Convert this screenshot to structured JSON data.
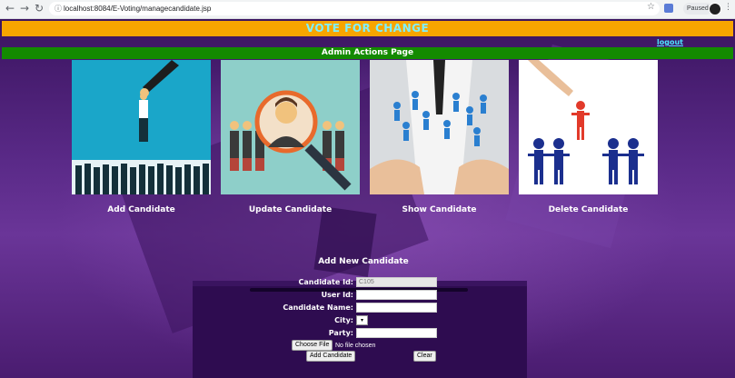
{
  "browser": {
    "url": "localhost:8084/E-Voting/managecandidate.jsp",
    "paused_label": "Paused"
  },
  "header": {
    "title": "VOTE FOR CHANGE",
    "logout_label": "logout",
    "subtitle": "Admin Actions Page"
  },
  "actions": [
    {
      "label": "Add Candidate"
    },
    {
      "label": "Update Candidate"
    },
    {
      "label": "Show Candidate"
    },
    {
      "label": "Delete Candidate"
    }
  ],
  "form": {
    "title": "Add New Candidate",
    "candidate_id_label": "Candidate Id:",
    "candidate_id_value": "C105",
    "user_id_label": "User Id:",
    "candidate_name_label": "Candidate Name:",
    "city_label": "City:",
    "party_label": "Party:",
    "choose_file_label": "Choose File",
    "no_file_label": "No file chosen",
    "submit_label": "Add Candidate",
    "clear_label": "Clear"
  },
  "colors": {
    "banner": "#f7a500",
    "banner_text": "#7ff0ff",
    "admin_bar": "#138a00",
    "background": "#5a2a88"
  }
}
